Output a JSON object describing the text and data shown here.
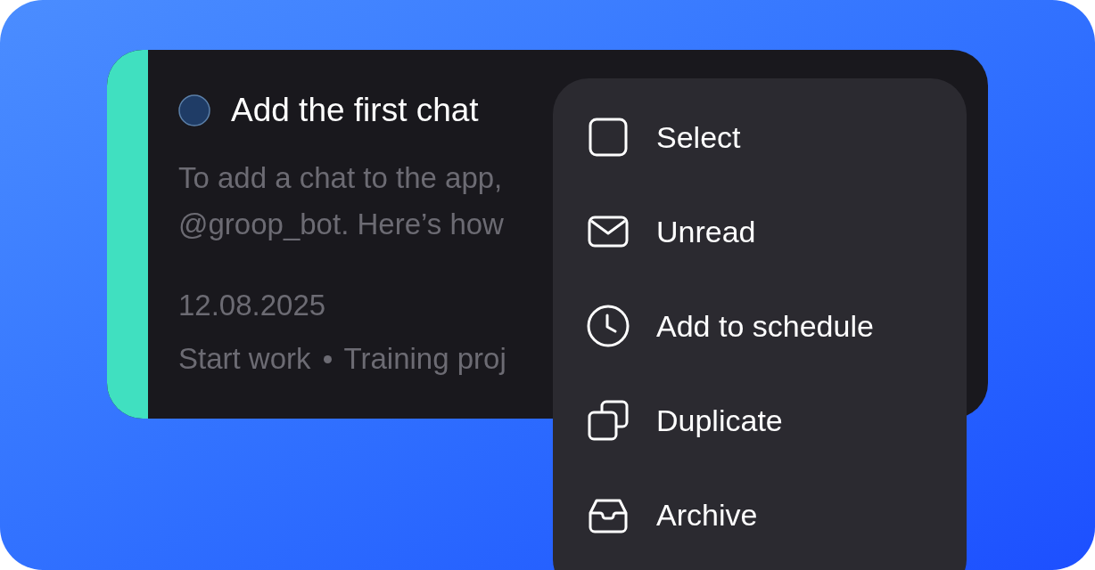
{
  "card": {
    "title": "Add the first chat",
    "description": [
      "To add a chat to the app,",
      "@groop_bot. Here’s how"
    ],
    "date": "12.08.2025",
    "meta": [
      "Start work",
      "Training proj"
    ]
  },
  "context_menu": {
    "items": [
      {
        "label": "Select"
      },
      {
        "label": "Unread"
      },
      {
        "label": "Add to schedule"
      },
      {
        "label": "Duplicate"
      },
      {
        "label": "Archive"
      }
    ]
  }
}
